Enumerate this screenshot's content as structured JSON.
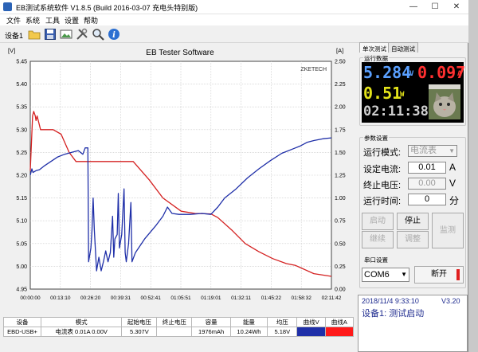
{
  "window": {
    "title": "EB测试系统软件 V1.8.5 (Build 2016-03-07 充电头特别版)"
  },
  "menu": [
    "文件",
    "系统",
    "工具",
    "设置",
    "帮助"
  ],
  "toolbar": {
    "device_label": "设备1"
  },
  "chart_data": {
    "type": "line",
    "title": "EB Tester Software",
    "watermark": "ZKETECH",
    "left_unit": "[V]",
    "right_unit": "[A]",
    "ylim": [
      4.95,
      5.45
    ],
    "y2lim": [
      0.0,
      2.5
    ],
    "y_ticks": [
      "5.45",
      "5.40",
      "5.35",
      "5.30",
      "5.25",
      "5.20",
      "5.15",
      "5.10",
      "5.05",
      "5.00",
      "4.95"
    ],
    "y2_ticks": [
      "2.50",
      "2.25",
      "2.00",
      "1.75",
      "1.50",
      "1.25",
      "1.00",
      "0.75",
      "0.50",
      "0.25",
      "0.00"
    ],
    "x_ticks": [
      "00:00:00",
      "00:13:10",
      "00:26:20",
      "00:39:31",
      "00:52:41",
      "01:05:51",
      "01:19:01",
      "01:32:11",
      "01:45:22",
      "01:58:32",
      "02:11:42"
    ],
    "xlim_minutes": [
      0,
      131.7
    ],
    "series": [
      {
        "color": "#d42020",
        "axis": "left",
        "points": [
          [
            0,
            5.21
          ],
          [
            1.0,
            5.33
          ],
          [
            1.5,
            5.34
          ],
          [
            2.2,
            5.33
          ],
          [
            2.5,
            5.32
          ],
          [
            3.0,
            5.33
          ],
          [
            4.5,
            5.3
          ],
          [
            7,
            5.3
          ],
          [
            10,
            5.3
          ],
          [
            13.5,
            5.29
          ],
          [
            17,
            5.25
          ],
          [
            20,
            5.23
          ],
          [
            30,
            5.23
          ],
          [
            40,
            5.23
          ],
          [
            45,
            5.23
          ],
          [
            52,
            5.19
          ],
          [
            58,
            5.15
          ],
          [
            66,
            5.121
          ],
          [
            72,
            5.116
          ],
          [
            79,
            5.115
          ],
          [
            82,
            5.107
          ],
          [
            88,
            5.08
          ],
          [
            94,
            5.05
          ],
          [
            100,
            5.032
          ],
          [
            106,
            5.017
          ],
          [
            112,
            5.006
          ],
          [
            116,
            5.002
          ],
          [
            124,
            4.984
          ],
          [
            131.7,
            4.978
          ]
        ]
      },
      {
        "color": "#1f2fa8",
        "axis": "right",
        "points": [
          [
            0,
            1.25
          ],
          [
            0.7,
            1.32
          ],
          [
            1.2,
            1.28
          ],
          [
            2.5,
            1.3
          ],
          [
            4,
            1.31
          ],
          [
            6,
            1.35
          ],
          [
            9,
            1.4
          ],
          [
            12,
            1.45
          ],
          [
            15,
            1.48
          ],
          [
            18,
            1.5
          ],
          [
            21,
            1.52
          ],
          [
            23,
            1.48
          ],
          [
            24,
            1.55
          ],
          [
            25.2,
            1.55
          ],
          [
            25.5,
            0.3
          ],
          [
            26.5,
            0.45
          ],
          [
            27,
            0.65
          ],
          [
            27.5,
            1.0
          ],
          [
            28,
            0.65
          ],
          [
            29,
            0.2
          ],
          [
            30,
            0.35
          ],
          [
            31,
            0.2
          ],
          [
            32,
            0.3
          ],
          [
            33,
            0.42
          ],
          [
            34,
            0.3
          ],
          [
            35,
            0.4
          ],
          [
            36,
            0.8
          ],
          [
            36.5,
            0.35
          ],
          [
            37,
            0.55
          ],
          [
            38,
            0.6
          ],
          [
            38.5,
            1.05
          ],
          [
            39,
            0.45
          ],
          [
            40,
            0.6
          ],
          [
            41,
            1.1
          ],
          [
            41.5,
            0.4
          ],
          [
            42,
            0.3
          ],
          [
            43,
            0.5
          ],
          [
            44,
            0.95
          ],
          [
            44.5,
            0.3
          ],
          [
            46,
            0.4
          ],
          [
            50,
            0.55
          ],
          [
            55,
            0.7
          ],
          [
            58,
            0.8
          ],
          [
            60,
            0.9
          ],
          [
            62,
            0.83
          ],
          [
            65,
            0.82
          ],
          [
            70,
            0.82
          ],
          [
            75,
            0.83
          ],
          [
            79,
            0.82
          ],
          [
            82,
            0.9
          ],
          [
            85,
            1.0
          ],
          [
            90,
            1.1
          ],
          [
            95,
            1.22
          ],
          [
            100,
            1.32
          ],
          [
            105,
            1.41
          ],
          [
            110,
            1.49
          ],
          [
            115,
            1.54
          ],
          [
            118,
            1.57
          ],
          [
            121,
            1.61
          ],
          [
            124,
            1.63
          ],
          [
            128,
            1.65
          ],
          [
            131.7,
            1.66
          ]
        ]
      }
    ]
  },
  "table": {
    "headers": [
      "设备",
      "模式",
      "起始电压",
      "终止电压",
      "容量",
      "能量",
      "均压",
      "曲线V",
      "曲线A"
    ],
    "row": [
      "EBD-USB+",
      "电流表  0.01A 0.00V",
      "5.307V",
      "",
      "1976mAh",
      "10.24Wh",
      "5.18V",
      "",
      ""
    ],
    "colors": {
      "curve_v": "#1f2fa8",
      "curve_a": "#ff1a1a"
    }
  },
  "panel": {
    "tabs": [
      "单次测试",
      "自动测试"
    ],
    "run_data_title": "运行数据",
    "voltage": "5.284",
    "voltage_unit": "V",
    "current": "0.097",
    "current_unit": "A",
    "power": "0.51",
    "power_unit": "W",
    "time": "02:11:38",
    "params_title": "参数设置",
    "mode_label": "运行模式:",
    "mode_value": "电流表",
    "current_label": "设定电流:",
    "current_set": "0.01",
    "current_set_unit": "A",
    "stop_voltage_label": "终止电压:",
    "stop_voltage": "0.00",
    "stop_voltage_unit": "V",
    "run_time_label": "运行时间:",
    "run_time": "0",
    "run_time_unit": "分",
    "buttons": {
      "start": "启动",
      "stop": "停止",
      "continue": "继续",
      "adjust": "调整",
      "monitor": "监测"
    },
    "port_title": "串口设置",
    "port": "COM6",
    "disconnect": "断开",
    "status_datetime": "2018/11/4 9:33:10",
    "status_version": "V3.20",
    "status_device": "设备1: 测试启动"
  }
}
